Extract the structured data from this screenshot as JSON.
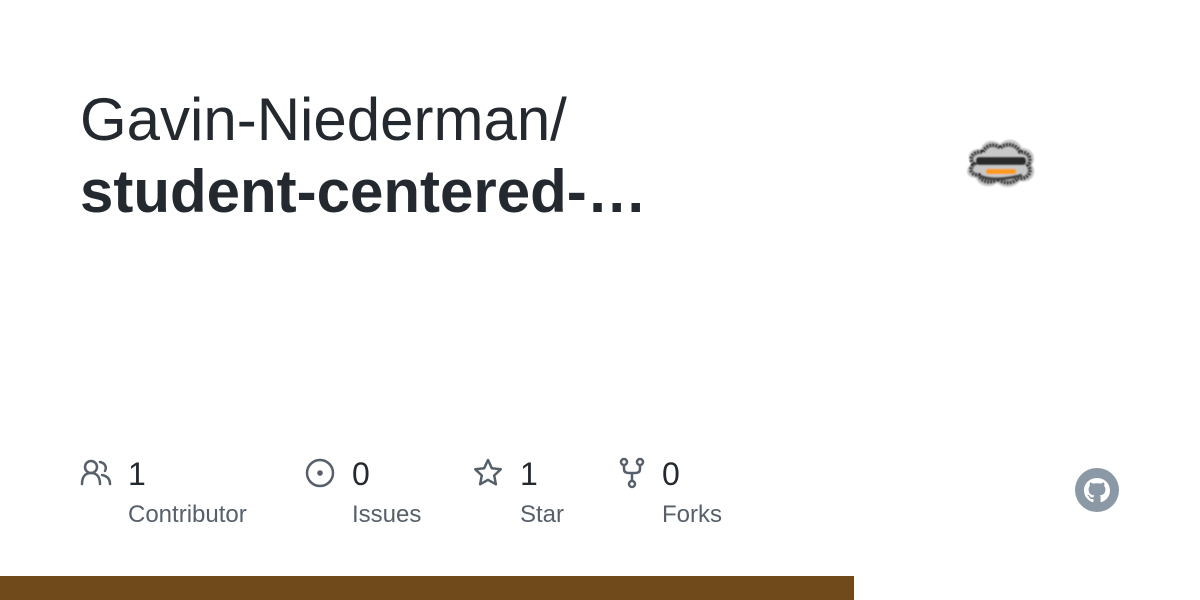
{
  "repository": {
    "owner": "Gavin-Niederman/",
    "name": "student-centered-…"
  },
  "stats": [
    {
      "icon": "people-icon",
      "count": "1",
      "label": "Contributor"
    },
    {
      "icon": "issue-open-icon",
      "count": "0",
      "label": "Issues"
    },
    {
      "icon": "star-icon",
      "count": "1",
      "label": "Star"
    },
    {
      "icon": "repo-forked-icon",
      "count": "0",
      "label": "Forks"
    }
  ],
  "avatar": {
    "icon": "user-avatar"
  },
  "brand": {
    "icon": "github-logo-icon",
    "color": "#8b98a5"
  },
  "language_bar": {
    "color": "#704a1a",
    "fraction": 0.7117
  },
  "colors": {
    "title": "#24292f",
    "secondary_text": "#57606a",
    "icon": "#57606a"
  }
}
